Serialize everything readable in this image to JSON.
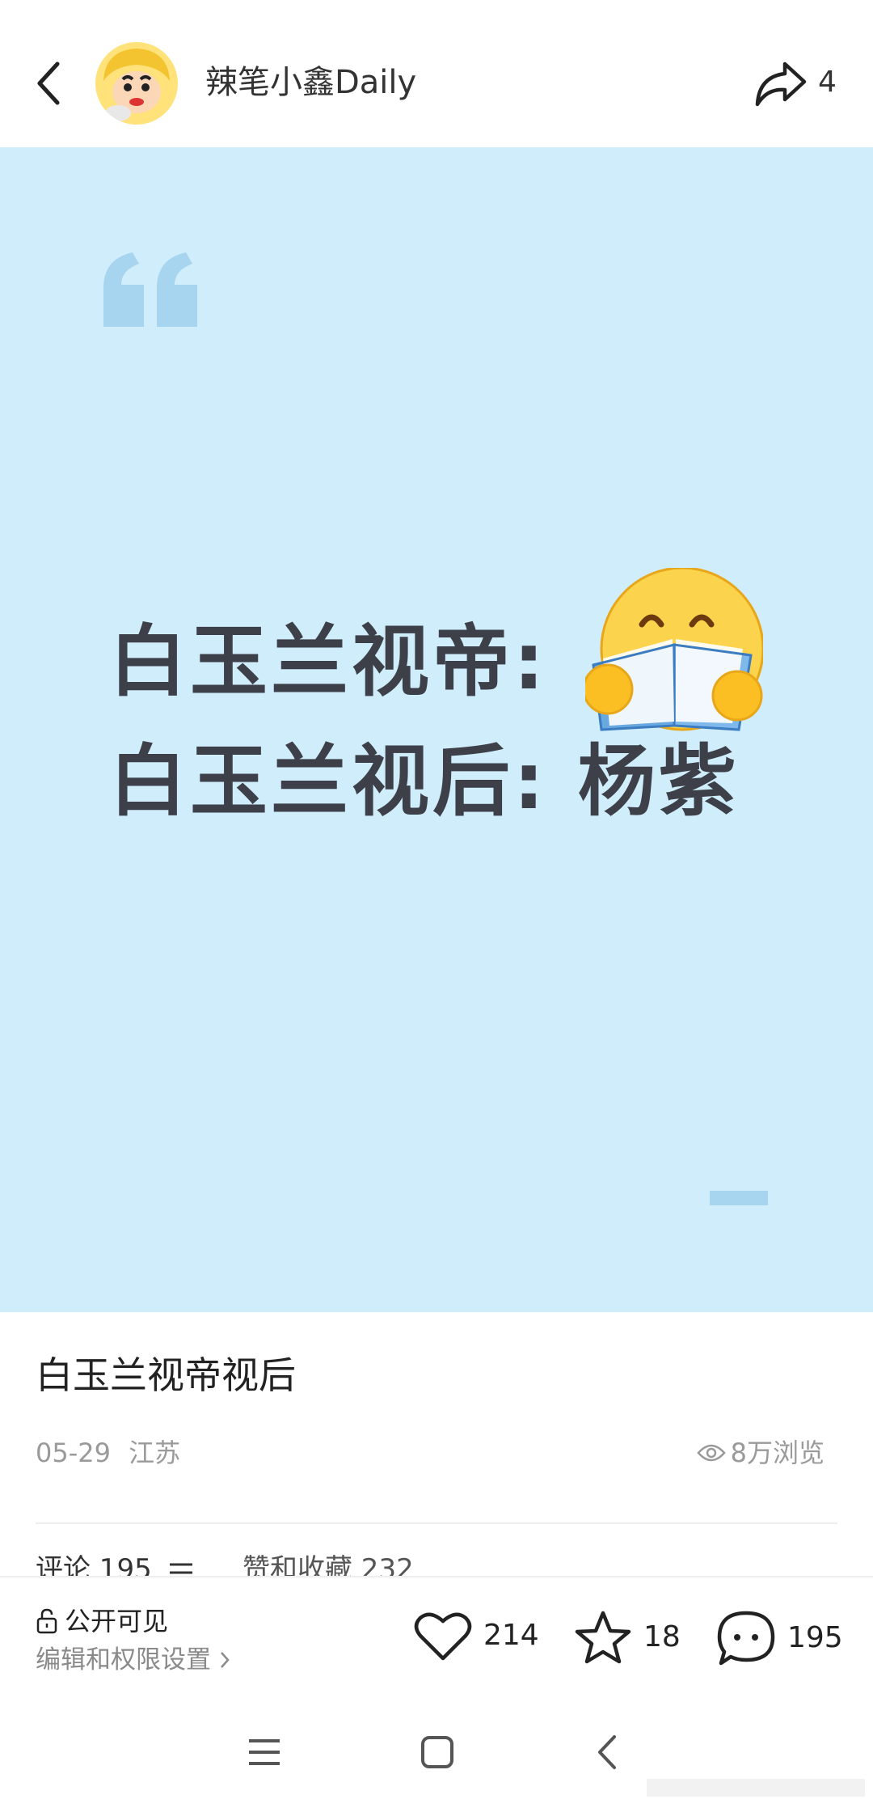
{
  "header": {
    "author_name": "辣笔小鑫Daily",
    "share_count": "4",
    "back_icon": "chevron-left-icon",
    "share_icon": "share-arrow-icon"
  },
  "image_card": {
    "background_color": "#d0edfb",
    "headline_line1": "白玉兰视帝:",
    "headline_line2": "白玉兰视后: 杨紫",
    "quote_icon": "quote-mark-icon",
    "emoji_icon": "reading-book-emoji-icon"
  },
  "post": {
    "title": "白玉兰视帝视后",
    "date": "05-29",
    "location": "江苏",
    "views": "8万浏览"
  },
  "tabs": {
    "comments": "评论 195",
    "likes_and_favorites": "赞和收藏 232"
  },
  "bottom_bar": {
    "visibility_label": "公开可见",
    "permission_link": "编辑和权限设置",
    "like_count": "214",
    "favorite_count": "18",
    "comment_count": "195"
  },
  "nav": {
    "menu_icon": "recent-apps-icon",
    "home_icon": "home-icon",
    "back_icon": "back-icon"
  }
}
